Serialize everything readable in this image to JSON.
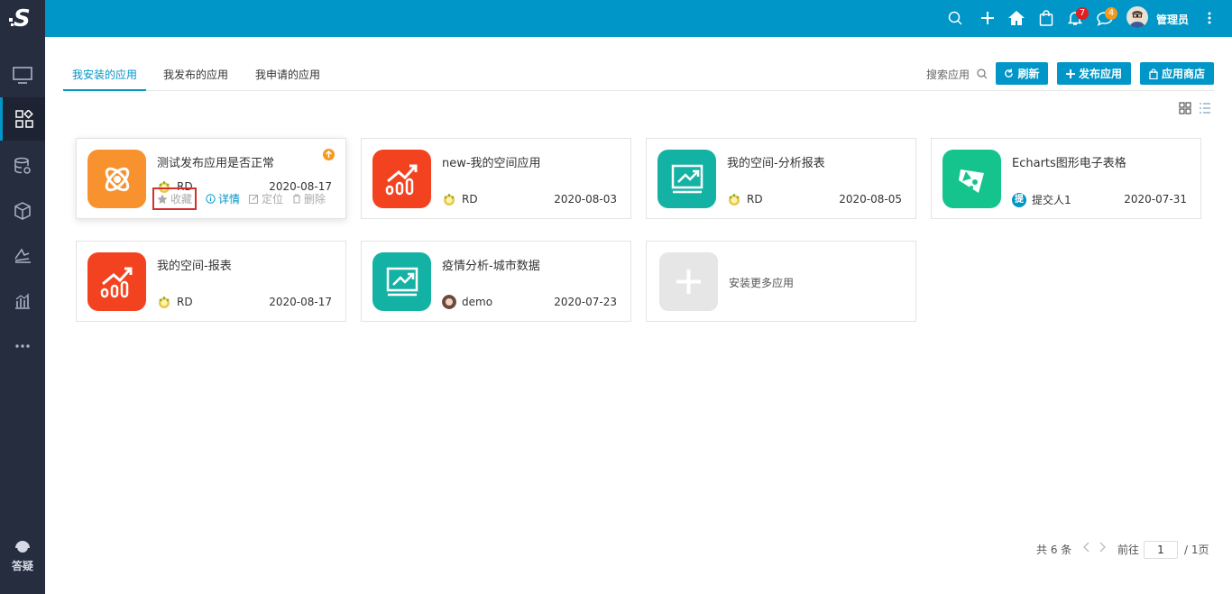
{
  "topbar": {
    "user_name": "管理员",
    "notify_badge": "7",
    "message_badge": "4",
    "icons": [
      "search-icon",
      "plus-icon",
      "home-icon",
      "bag-icon",
      "bell-icon",
      "chat-icon",
      "more-vert-icon"
    ]
  },
  "sidebar": {
    "items": [
      "monitor-icon",
      "apps-icon",
      "database-icon",
      "cube-icon",
      "layers-icon",
      "bar-chart-icon",
      "ellipsis-icon"
    ],
    "help_label": "答疑"
  },
  "tabs": [
    {
      "label": "我安装的应用",
      "active": true
    },
    {
      "label": "我发布的应用",
      "active": false
    },
    {
      "label": "我申请的应用",
      "active": false
    }
  ],
  "toolbar": {
    "search_label": "搜索应用",
    "refresh_label": "刷新",
    "publish_label": "发布应用",
    "store_label": "应用商店"
  },
  "cards": [
    {
      "title": "测试发布应用是否正常",
      "owner": "RD",
      "date": "2020-08-17",
      "icon_color": "#f7922f",
      "icon": "atom-icon",
      "actions": {
        "fav": "收藏",
        "detail": "详情",
        "locate": "定位",
        "delete": "删除"
      }
    },
    {
      "title": "new-我的空间应用",
      "owner": "RD",
      "date": "2020-08-03",
      "icon_color": "#f3421f",
      "icon": "growth-chart-icon"
    },
    {
      "title": "我的空间-分析报表",
      "owner": "RD",
      "date": "2020-08-05",
      "icon_color": "#14b2a4",
      "icon": "trend-board-icon"
    },
    {
      "title": "Echarts图形电子表格",
      "owner": "提交人1",
      "owner_initial": "提",
      "date": "2020-07-31",
      "icon_color": "#15c48d",
      "icon": "cube-cut-icon"
    },
    {
      "title": "我的空间-报表",
      "owner": "RD",
      "date": "2020-08-17",
      "icon_color": "#f3421f",
      "icon": "growth-chart-icon"
    },
    {
      "title": "疫情分析-城市数据",
      "owner": "demo",
      "date": "2020-07-23",
      "icon_color": "#14b2a4",
      "icon": "trend-board-icon"
    }
  ],
  "add_card": {
    "label": "安装更多应用"
  },
  "pager": {
    "total": "共 6 条",
    "goto": "前往",
    "page": "1",
    "pages": "/ 1页"
  }
}
